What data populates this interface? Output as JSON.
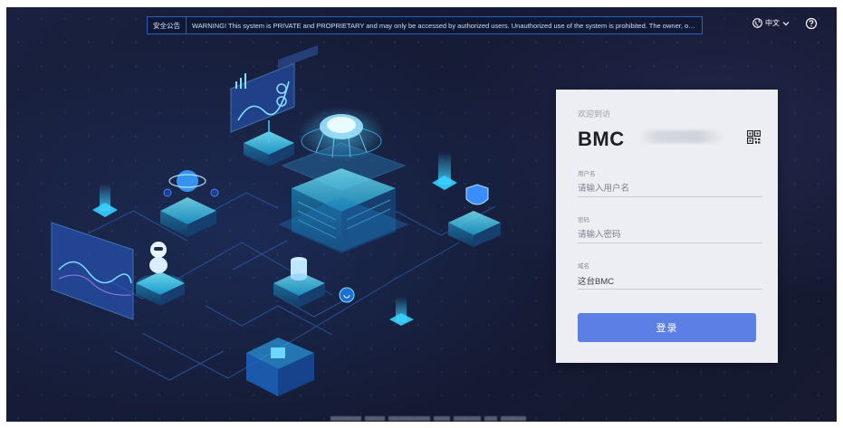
{
  "banner": {
    "tag": "安全公告",
    "message": "WARNING! This system is PRIVATE and PROPRIETARY and may only be accessed by authorized users. Unauthorized use of the system is prohibited. The owner, or its agents, may ..."
  },
  "language": {
    "label": "中文",
    "icon": "globe-icon"
  },
  "help": {
    "icon": "help-circle-icon"
  },
  "login": {
    "welcome": "欢迎到访",
    "brand": "BMC",
    "username_label": "用户名",
    "username_placeholder": "请输入用户名",
    "password_label": "密码",
    "password_placeholder": "请输入密码",
    "domain_label": "域名",
    "domain_value": "这台BMC",
    "submit_label": "登录",
    "qr_icon": "qr-code-icon"
  },
  "colors": {
    "background": "#171c36",
    "accent": "#5b7fe4",
    "card": "#eceef3",
    "banner_border": "#2e5fb8",
    "glow": "#39d0ff"
  }
}
